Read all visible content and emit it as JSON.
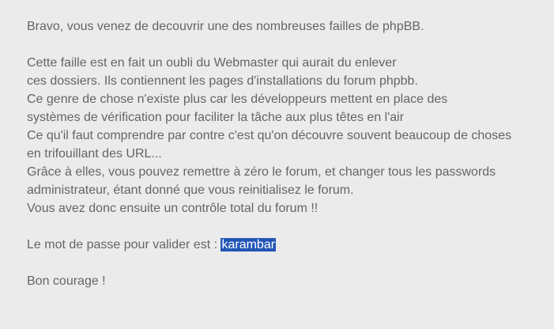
{
  "intro": "Bravo, vous venez de decouvrir une des nombreuses failles de phpBB.",
  "body_lines": [
    "Cette faille est en fait un oubli du Webmaster qui aurait du enlever",
    "ces dossiers. Ils contiennent les pages d'installations du forum phpbb.",
    "Ce genre de chose n'existe plus car les développeurs mettent en place des",
    "systèmes de vérification pour faciliter la tâche aux plus têtes en l'air",
    "Ce qu'il faut comprendre par contre c'est qu'on découvre souvent beaucoup de choses",
    "en trifouillant des URL...",
    "Grâce à elles, vous pouvez remettre à zéro le forum, et changer tous les passwords",
    "administrateur, étant donné que vous reinitialisez le forum.",
    "Vous avez donc ensuite un contrôle total du forum !!"
  ],
  "password_label": "Le mot de passe pour valider est : ",
  "password_value": "karambar",
  "closing": "Bon courage !",
  "colors": {
    "background": "#ebebeb",
    "text": "#656565",
    "selection": "#2356b6"
  }
}
